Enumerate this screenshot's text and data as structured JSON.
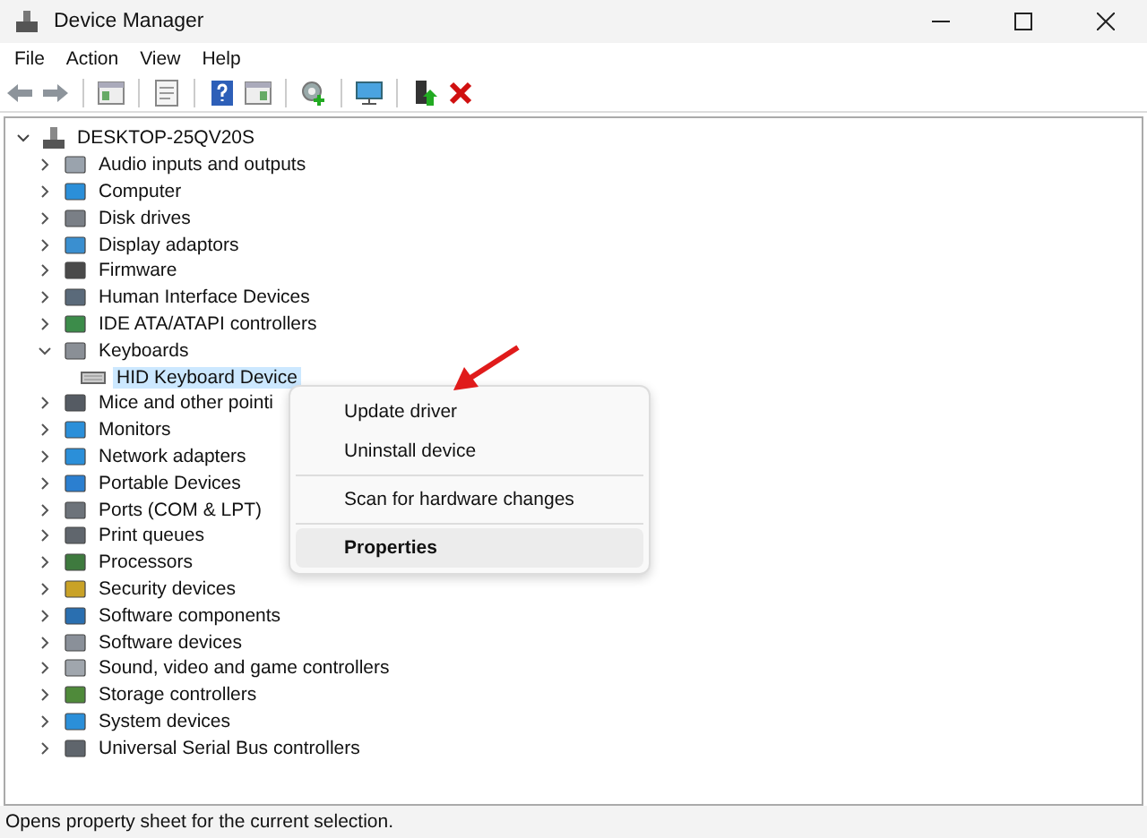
{
  "window": {
    "title": "Device Manager"
  },
  "menu_bar": [
    "File",
    "Action",
    "View",
    "Help"
  ],
  "tree": {
    "label": "DESKTOP-25QV20S",
    "expanded": true,
    "children": [
      {
        "label": "Audio inputs and outputs",
        "expanded": false
      },
      {
        "label": "Computer",
        "expanded": false
      },
      {
        "label": "Disk drives",
        "expanded": false
      },
      {
        "label": "Display adaptors",
        "expanded": false
      },
      {
        "label": "Firmware",
        "expanded": false
      },
      {
        "label": "Human Interface Devices",
        "expanded": false
      },
      {
        "label": "IDE ATA/ATAPI controllers",
        "expanded": false
      },
      {
        "label": "Keyboards",
        "expanded": true,
        "children": [
          {
            "label": "HID Keyboard Device",
            "selected": true
          }
        ]
      },
      {
        "label": "Mice and other pointi",
        "expanded": false
      },
      {
        "label": "Monitors",
        "expanded": false
      },
      {
        "label": "Network adapters",
        "expanded": false
      },
      {
        "label": "Portable Devices",
        "expanded": false
      },
      {
        "label": "Ports (COM & LPT)",
        "expanded": false
      },
      {
        "label": "Print queues",
        "expanded": false
      },
      {
        "label": "Processors",
        "expanded": false
      },
      {
        "label": "Security devices",
        "expanded": false
      },
      {
        "label": "Software components",
        "expanded": false
      },
      {
        "label": "Software devices",
        "expanded": false
      },
      {
        "label": "Sound, video and game controllers",
        "expanded": false
      },
      {
        "label": "Storage controllers",
        "expanded": false
      },
      {
        "label": "System devices",
        "expanded": false
      },
      {
        "label": "Universal Serial Bus controllers",
        "expanded": false
      }
    ]
  },
  "context_menu": {
    "groups": [
      [
        {
          "label": "Update driver",
          "selected": false,
          "default": false
        },
        {
          "label": "Uninstall device",
          "selected": false,
          "default": false
        }
      ],
      [
        {
          "label": "Scan for hardware changes",
          "selected": false,
          "default": false
        }
      ],
      [
        {
          "label": "Properties",
          "selected": true,
          "default": true
        }
      ]
    ]
  },
  "status_bar": "Opens property sheet for the current selection."
}
